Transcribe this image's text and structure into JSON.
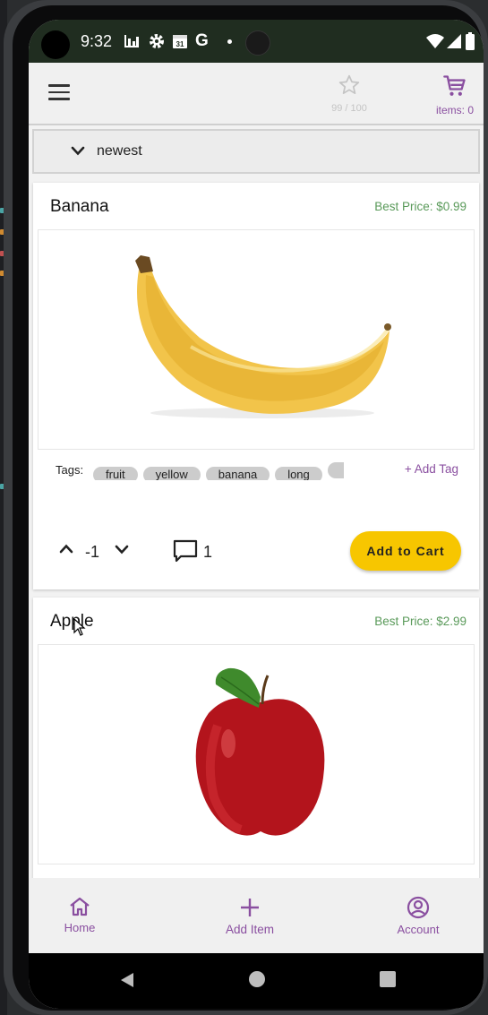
{
  "status_bar": {
    "time": "9:32"
  },
  "app_bar": {
    "favorites_count": "99 / 100",
    "cart_items": "items: 0"
  },
  "sort": {
    "label": "newest"
  },
  "products": [
    {
      "name": "Banana",
      "best_price": "Best Price: $0.99",
      "image": "banana",
      "tags_label": "Tags:",
      "tags": [
        "fruit",
        "yellow",
        "banana",
        "long",
        ""
      ],
      "add_tag": "+ Add Tag",
      "votes": "-1",
      "comments": "1",
      "add_to_cart": "Add to Cart"
    },
    {
      "name": "Apple",
      "best_price": "Best Price: $2.99",
      "image": "apple"
    }
  ],
  "bottom_nav": {
    "home": "Home",
    "add_item": "Add Item",
    "account": "Account"
  },
  "colors": {
    "accent": "#8a4fa0",
    "price_green": "#5a9a5a",
    "cart_button": "#f7c600",
    "status_bar": "#202d20"
  }
}
